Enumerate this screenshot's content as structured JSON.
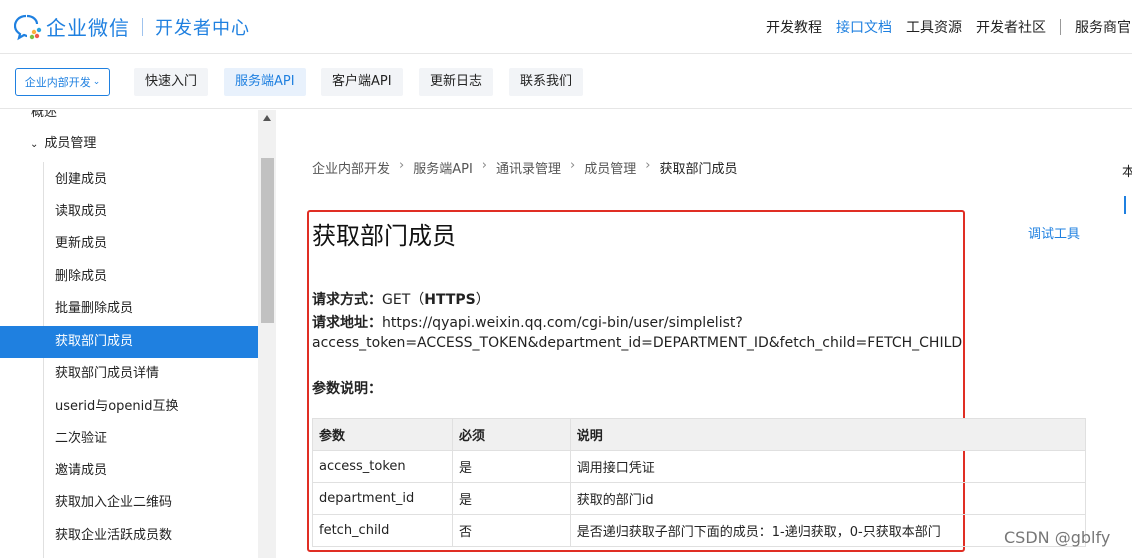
{
  "header": {
    "brand": "企业微信",
    "subtitle": "开发者中心",
    "nav": [
      "开发教程",
      "接口文档",
      "工具资源",
      "开发者社区",
      "服务商官网"
    ],
    "active_nav_index": 1
  },
  "subbar": {
    "selector_label": "企业内部开发",
    "tabs": [
      "快速入门",
      "服务端API",
      "客户端API",
      "更新日志",
      "联系我们"
    ],
    "active_tab_index": 1
  },
  "sidebar": {
    "overview": "概述",
    "group": "成员管理",
    "items": [
      "创建成员",
      "读取成员",
      "更新成员",
      "删除成员",
      "批量删除成员",
      "获取部门成员",
      "获取部门成员详情",
      "userid与openid互换",
      "二次验证",
      "邀请成员",
      "获取加入企业二维码",
      "获取企业活跃成员数"
    ],
    "active_index": 5
  },
  "breadcrumb": [
    "企业内部开发",
    "服务端API",
    "通讯录管理",
    "成员管理",
    "获取部门成员"
  ],
  "doc": {
    "title": "获取部门成员",
    "debug_tool": "调试工具",
    "method_label": "请求方式：",
    "method_value": "GET（",
    "method_bold": "HTTPS",
    "method_end": "）",
    "url_label": "请求地址：",
    "url_line1": "https://qyapi.weixin.qq.com/cgi-bin/user/simplelist?",
    "url_line2": "access_token=ACCESS_TOKEN&department_id=DEPARTMENT_ID&fetch_child=FETCH_CHILD",
    "params_label": "参数说明：",
    "table": {
      "headers": [
        "参数",
        "必须",
        "说明"
      ],
      "rows": [
        [
          "access_token",
          "是",
          "调用接口凭证"
        ],
        [
          "department_id",
          "是",
          "获取的部门id"
        ],
        [
          "fetch_child",
          "否",
          "是否递归获取子部门下面的成员：1-递归获取，0-只获取本部门"
        ]
      ]
    }
  },
  "right_fragment": "本",
  "watermark": "CSDN @gblfy",
  "colors": {
    "accent": "#1f80e0",
    "highlight_box": "#e02e24"
  }
}
